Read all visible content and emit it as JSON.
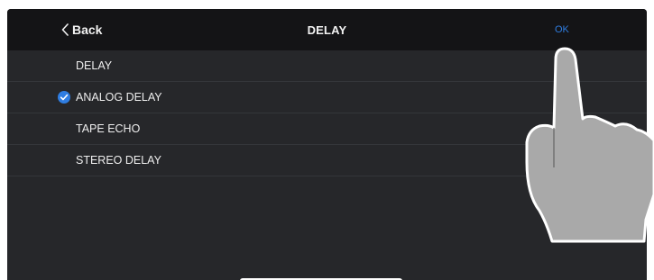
{
  "navbar": {
    "back_label": "Back",
    "title": "DELAY",
    "ok_label": "OK"
  },
  "list": {
    "items": [
      {
        "label": "DELAY",
        "selected": false
      },
      {
        "label": "ANALOG DELAY",
        "selected": true
      },
      {
        "label": "TAPE ECHO",
        "selected": false
      },
      {
        "label": "STEREO DELAY",
        "selected": false
      }
    ]
  },
  "colors": {
    "background": "#26272a",
    "navbar": "#141416",
    "accent": "#2f7de1",
    "text": "#eeeeee",
    "hand_fill": "#a9a9a9"
  },
  "icons": {
    "back": "chevron-left-icon",
    "selected": "checkmark-circle-icon",
    "pointer": "pointing-hand-icon"
  }
}
